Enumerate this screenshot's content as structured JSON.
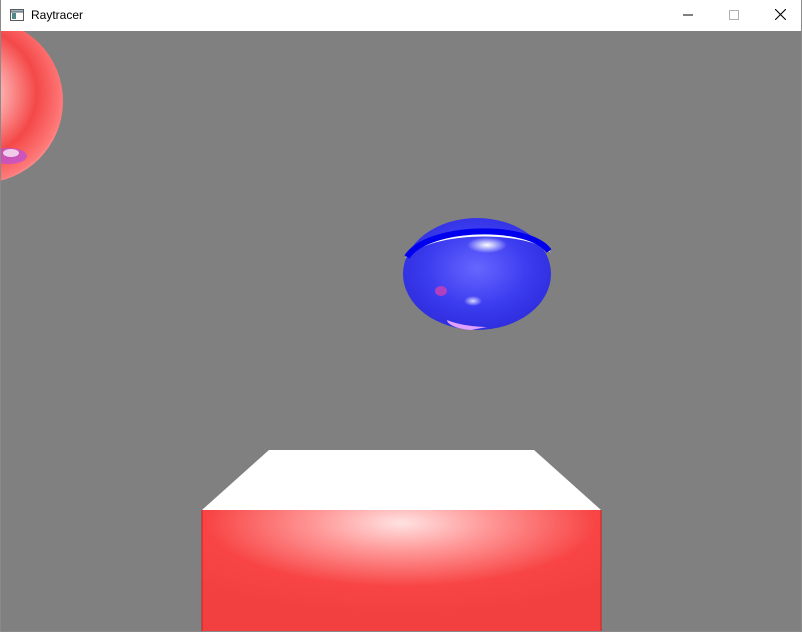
{
  "window": {
    "title": "Raytracer",
    "controls": {
      "minimize_icon": "minimize-icon",
      "maximize_icon": "maximize-icon",
      "close_icon": "close-icon"
    }
  },
  "scene": {
    "background_color": "#808080",
    "objects": [
      {
        "name": "red-sphere",
        "color": "#ff4a4a",
        "highlight": "#ffffff"
      },
      {
        "name": "blue-ellipsoid",
        "color": "#3a3af0",
        "highlight": "#ffffff"
      },
      {
        "name": "red-box",
        "front_color": "#f84444",
        "top_color": "#ffffff"
      }
    ]
  }
}
